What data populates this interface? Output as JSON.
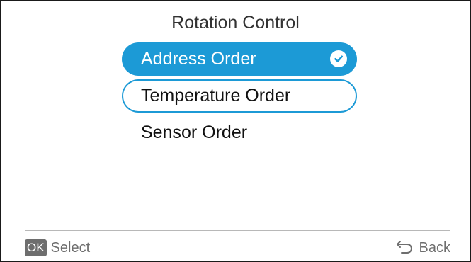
{
  "screen": {
    "title": "Rotation Control"
  },
  "menu": {
    "items": [
      {
        "label": "Address Order",
        "state": "selected"
      },
      {
        "label": "Temperature Order",
        "state": "focused"
      },
      {
        "label": "Sensor Order",
        "state": "normal"
      }
    ]
  },
  "footer": {
    "ok_key": "OK",
    "select_label": "Select",
    "back_label": "Back",
    "back_icon": "back-arrow-icon"
  },
  "colors": {
    "accent": "#1c9ad6",
    "footer_text": "#6e6e6e",
    "title_text": "#333333"
  }
}
